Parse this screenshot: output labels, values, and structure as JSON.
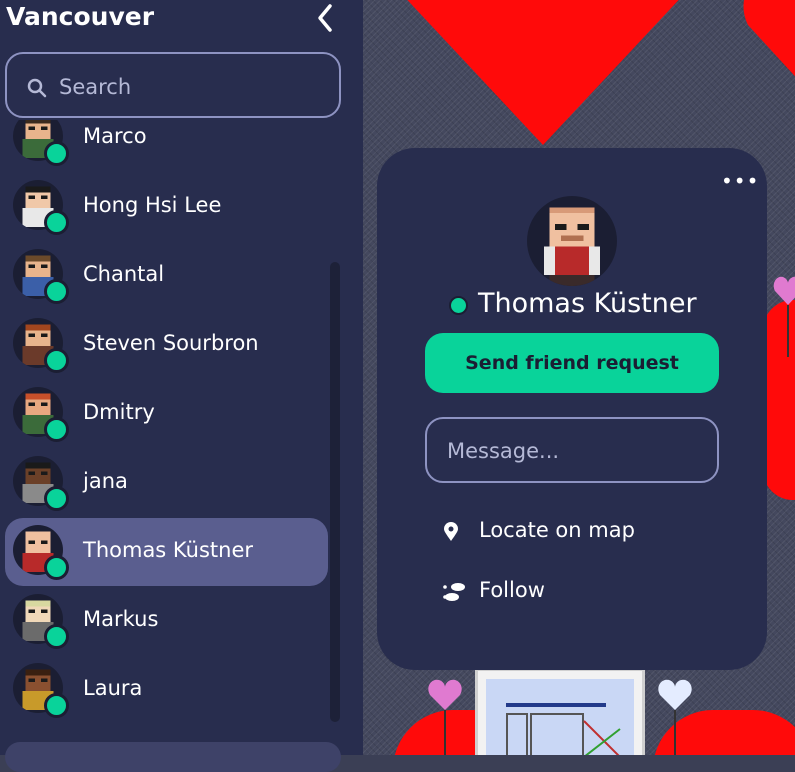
{
  "sidebar": {
    "title": "Vancouver",
    "search_placeholder": "Search",
    "users": [
      {
        "name": "Marco",
        "skin": "#e8b48c",
        "hair": "#3a2a1e",
        "shirt": "#3b6b3a",
        "active": false
      },
      {
        "name": "Hong Hsi Lee",
        "skin": "#f0c8a8",
        "hair": "#1a1a1a",
        "shirt": "#e8e8e8",
        "active": false
      },
      {
        "name": "Chantal",
        "skin": "#e8b48c",
        "hair": "#6b4a2a",
        "shirt": "#3b5fa8",
        "active": false
      },
      {
        "name": "Steven Sourbron",
        "skin": "#e8b48c",
        "hair": "#a2461e",
        "shirt": "#6b3a2a",
        "active": false
      },
      {
        "name": "Dmitry",
        "skin": "#e8a880",
        "hair": "#c8502a",
        "shirt": "#3b6b3a",
        "active": false
      },
      {
        "name": "jana",
        "skin": "#6b4028",
        "hair": "#1a1a1a",
        "shirt": "#8a8a8a",
        "active": false
      },
      {
        "name": "Thomas Küstner",
        "skin": "#f0c0a0",
        "hair": "#f0c0a0",
        "shirt": "#b82a2a",
        "active": true
      },
      {
        "name": "Markus",
        "skin": "#f0d8b8",
        "hair": "#d8d8a0",
        "shirt": "#6b6b6b",
        "active": false
      },
      {
        "name": "Laura",
        "skin": "#8a5030",
        "hair": "#3a2010",
        "shirt": "#c89a2a",
        "active": false
      }
    ]
  },
  "profile": {
    "name": "Thomas Küstner",
    "friend_button": "Send friend request",
    "message_placeholder": "Message...",
    "locate_label": "Locate on map",
    "follow_label": "Follow"
  },
  "colors": {
    "online": "#09d39a",
    "panel": "#282d4e",
    "active_row": "#5a5e8f",
    "heart": "#ff0a0a"
  }
}
